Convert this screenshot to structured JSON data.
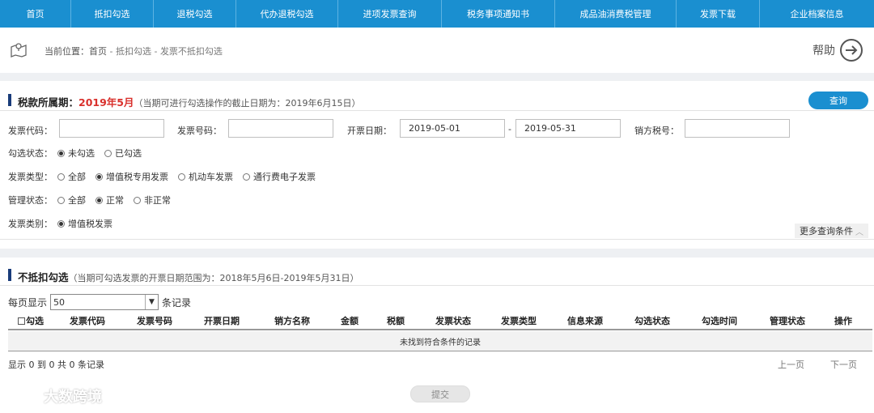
{
  "nav": {
    "items": [
      "首页",
      "抵扣勾选",
      "退税勾选",
      "代办退税勾选",
      "进项发票查询",
      "税务事项通知书",
      "成品油消费税管理",
      "发票下载",
      "企业档案信息"
    ]
  },
  "breadcrumb": {
    "prefix": "当前位置：",
    "items": [
      "首页",
      "抵扣勾选",
      "发票不抵扣勾选"
    ],
    "sep": " - "
  },
  "help": {
    "label": "帮助"
  },
  "query": {
    "title": "税款所属期：",
    "period": "2019年5月",
    "deadline_note": "（当期可进行勾选操作的截止日期为：2019年6月15日）",
    "button": "查询",
    "fields": {
      "invoice_code_label": "发票代码：",
      "invoice_code_value": "",
      "invoice_no_label": "发票号码：",
      "invoice_no_value": "",
      "issue_date_label": "开票日期：",
      "date_from": "2019-05-01",
      "date_sep": "-",
      "date_to": "2019-05-31",
      "seller_tax_label": "销方税号：",
      "seller_tax_value": ""
    },
    "check_status": {
      "label": "勾选状态：",
      "options": [
        "未勾选",
        "已勾选"
      ],
      "selected": 0
    },
    "invoice_type": {
      "label": "发票类型：",
      "options": [
        "全部",
        "增值税专用发票",
        "机动车发票",
        "通行费电子发票"
      ],
      "selected": 1
    },
    "manage_status": {
      "label": "管理状态：",
      "options": [
        "全部",
        "正常",
        "非正常"
      ],
      "selected": 1
    },
    "invoice_category": {
      "label": "发票类别：",
      "options": [
        "增值税发票"
      ],
      "selected": 0
    },
    "more_conditions": "更多查询条件"
  },
  "results": {
    "title": "不抵扣勾选",
    "range_note": "（当期可勾选发票的开票日期范围为：2018年5月6日-2019年5月31日）",
    "page_size_prefix": "每页显示",
    "page_size_value": "50",
    "page_size_suffix": "条记录",
    "columns": [
      "勾选",
      "发票代码",
      "发票号码",
      "开票日期",
      "销方名称",
      "金额",
      "税额",
      "发票状态",
      "发票类型",
      "信息来源",
      "勾选状态",
      "勾选时间",
      "管理状态",
      "操作"
    ],
    "empty_message": "未找到符合条件的记录",
    "info": "显示 0 到 0 共 0 条记录",
    "prev": "上一页",
    "next": "下一页",
    "submit": "提交"
  },
  "watermark": {
    "text": "大数跨境"
  },
  "colors": {
    "nav_bg": "#1a8fd0",
    "period_red": "#d9302c",
    "section_bar": "#1a3c7a"
  }
}
